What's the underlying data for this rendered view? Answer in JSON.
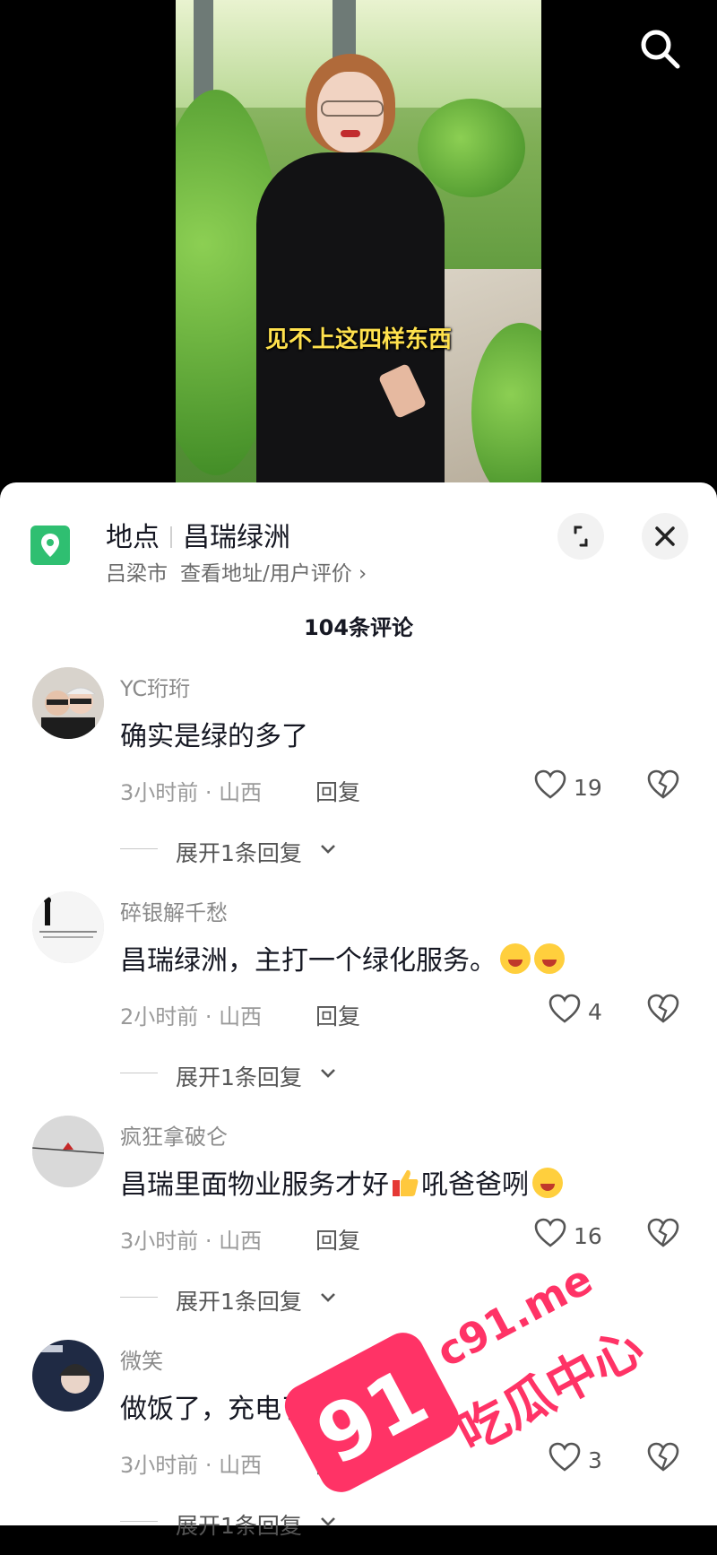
{
  "video": {
    "subtitle": "见不上这四样东西"
  },
  "location": {
    "label": "地点",
    "name": "昌瑞绿洲",
    "city": "吕梁市",
    "link": "查看地址/用户评价 ›"
  },
  "comment_count": "104条评论",
  "comments": [
    {
      "user": "YC珩珩",
      "text": "确实是绿的多了",
      "emoji": "",
      "meta": "3小时前 · 山西",
      "reply": "回复",
      "likes": "19",
      "expand": "展开1条回复"
    },
    {
      "user": "碎银解千愁",
      "text": "昌瑞绿洲，主打一个绿化服务。",
      "emoji": "🤣🤣",
      "meta": "2小时前 · 山西",
      "reply": "回复",
      "likes": "4",
      "expand": "展开1条回复"
    },
    {
      "user": "疯狂拿破仑",
      "text": "昌瑞里面物业服务才好",
      "emoji": "👍",
      "text2": "吼爸爸咧",
      "emoji2": "😂",
      "meta": "3小时前 · 山西",
      "reply": "回复",
      "likes": "16",
      "expand": "展开1条回复"
    },
    {
      "user": "微笑",
      "text": "做饭了，充电了",
      "emoji": "",
      "meta": "3小时前 · 山西",
      "reply": "回复",
      "likes": "3",
      "expand": "展开1条回复"
    }
  ],
  "watermark": {
    "badge": "91",
    "site": "c91.me",
    "brand": "吃瓜中心"
  },
  "icons": {
    "search": "search-icon",
    "location": "location-pin-icon",
    "expand": "expand-icon",
    "close": "close-icon",
    "like": "heart-icon",
    "dislike": "broken-heart-icon",
    "chevron": "chevron-down-icon"
  },
  "colors": {
    "accent_green": "#2fbf71",
    "subtitle_yellow": "#ffe14d",
    "watermark_pink": "#ff3366"
  }
}
